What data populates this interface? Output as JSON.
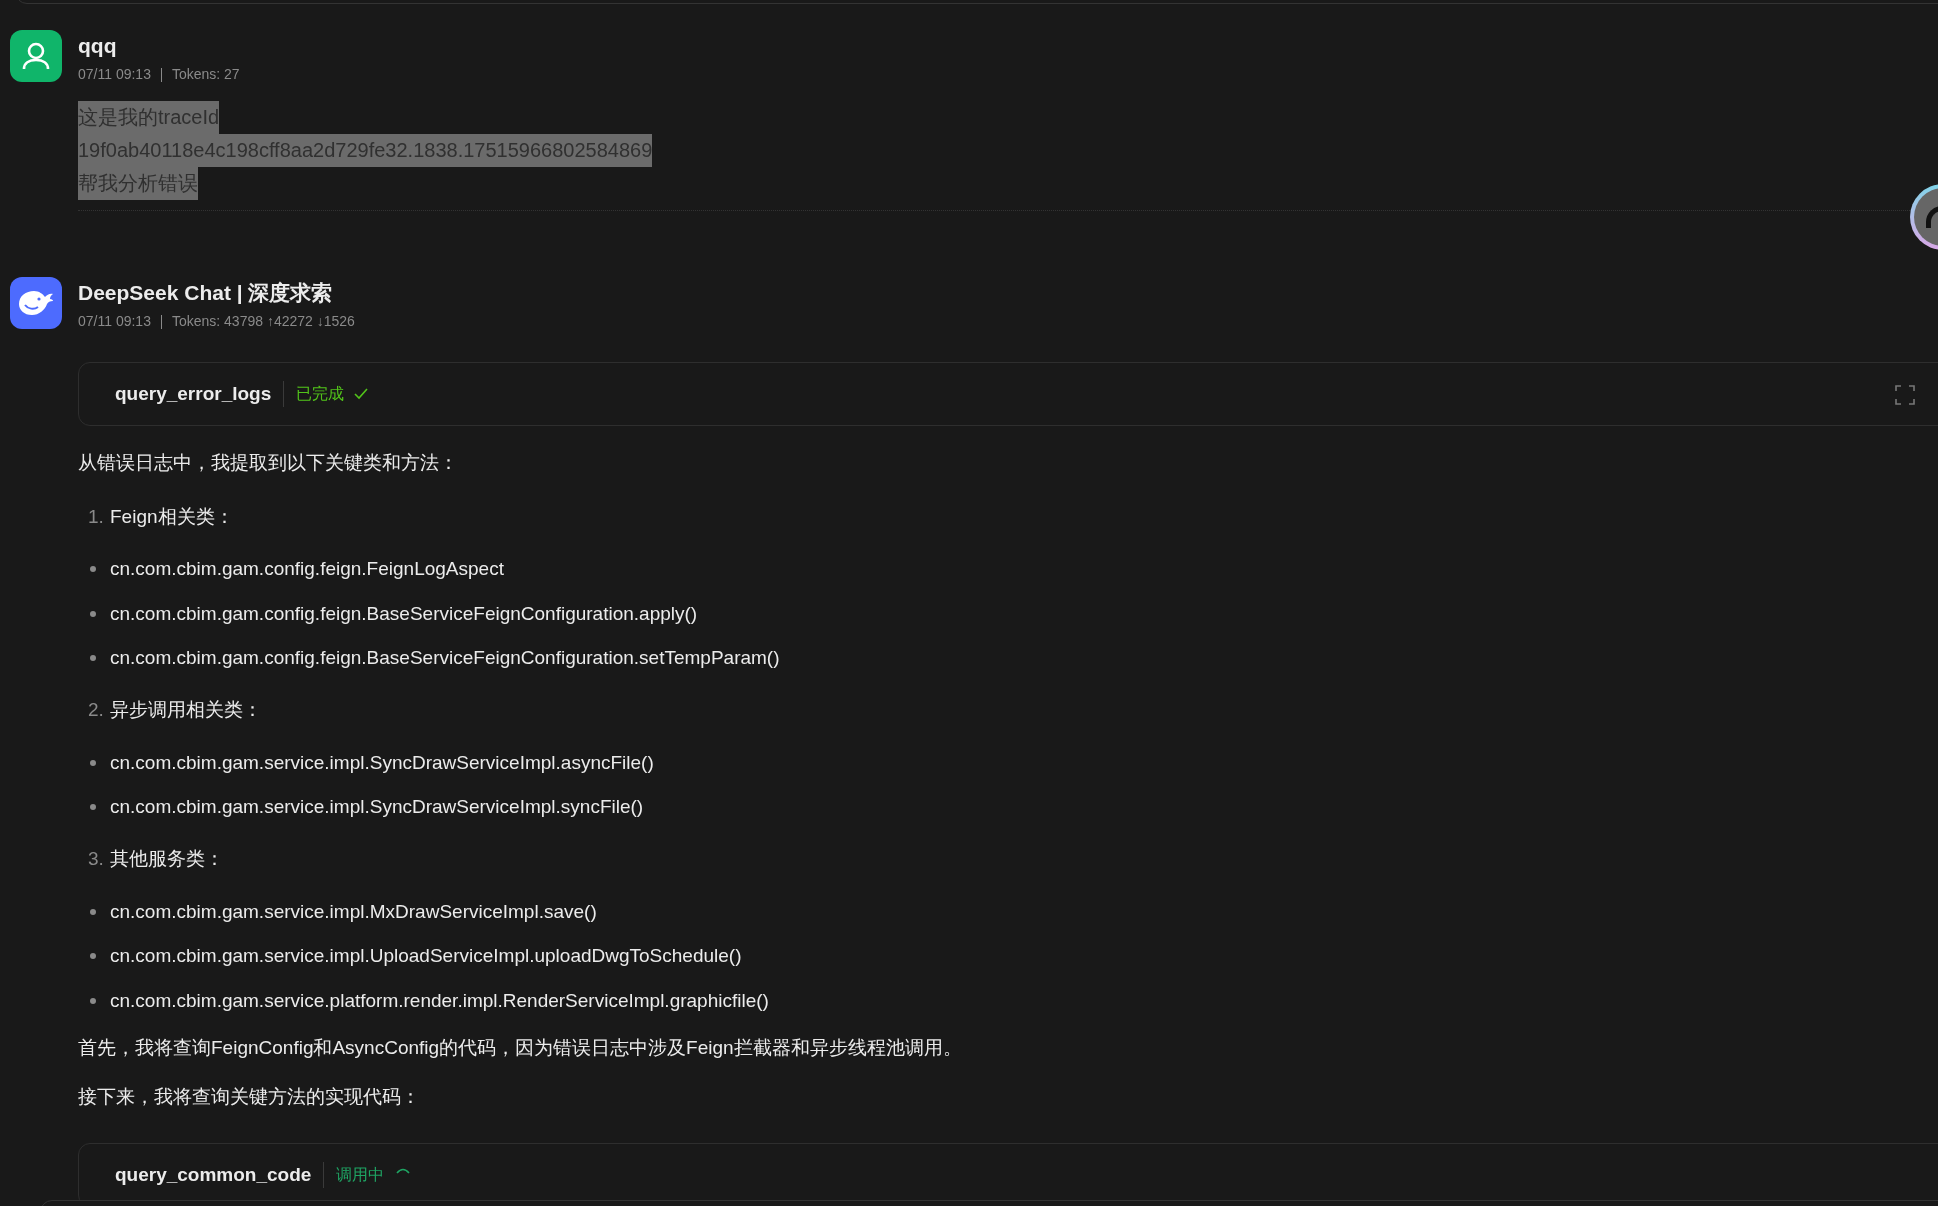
{
  "messages": [
    {
      "kind": "user",
      "author": "qqq",
      "time": "07/11 09:13",
      "tokens": "Tokens: 27",
      "text_selected": true,
      "lines": [
        "这是我的traceId",
        "19f0ab40118e4c198cff8aa2d729fe32.1838.17515966802584869",
        "帮我分析错误"
      ]
    },
    {
      "kind": "assistant",
      "author": "DeepSeek Chat | 深度求索",
      "time": "07/11 09:13",
      "tokens": "Tokens: 43798 ↑42272 ↓1526",
      "blocks": [
        {
          "kind": "tool",
          "name": "query_error_logs",
          "status": "已完成",
          "done": true
        },
        {
          "kind": "paragraph",
          "text": "从错误日志中，我提取到以下关键类和方法："
        },
        {
          "kind": "numbered",
          "number": "1.",
          "text": "Feign相关类："
        },
        {
          "kind": "bullet",
          "text": "cn.com.cbim.gam.config.feign.FeignLogAspect"
        },
        {
          "kind": "bullet",
          "text": "cn.com.cbim.gam.config.feign.BaseServiceFeignConfiguration.apply()"
        },
        {
          "kind": "bullet",
          "text": "cn.com.cbim.gam.config.feign.BaseServiceFeignConfiguration.setTempParam()"
        },
        {
          "kind": "numbered",
          "number": "2.",
          "text": "异步调用相关类："
        },
        {
          "kind": "bullet",
          "text": "cn.com.cbim.gam.service.impl.SyncDrawServiceImpl.asyncFile()"
        },
        {
          "kind": "bullet",
          "text": "cn.com.cbim.gam.service.impl.SyncDrawServiceImpl.syncFile()"
        },
        {
          "kind": "numbered",
          "number": "3.",
          "text": "其他服务类："
        },
        {
          "kind": "bullet",
          "text": "cn.com.cbim.gam.service.impl.MxDrawServiceImpl.save()"
        },
        {
          "kind": "bullet",
          "text": "cn.com.cbim.gam.service.impl.UploadServiceImpl.uploadDwgToSchedule()"
        },
        {
          "kind": "bullet",
          "text": "cn.com.cbim.gam.service.platform.render.impl.RenderServiceImpl.graphicfile()"
        },
        {
          "kind": "paragraph",
          "text": "首先，我将查询FeignConfig和AsyncConfig的代码，因为错误日志中涉及Feign拦截器和异步线程池调用。"
        },
        {
          "kind": "paragraph",
          "text": "接下来，我将查询关键方法的实现代码："
        },
        {
          "kind": "tool",
          "name": "query_common_code",
          "status": "调用中",
          "done": false
        }
      ]
    }
  ]
}
